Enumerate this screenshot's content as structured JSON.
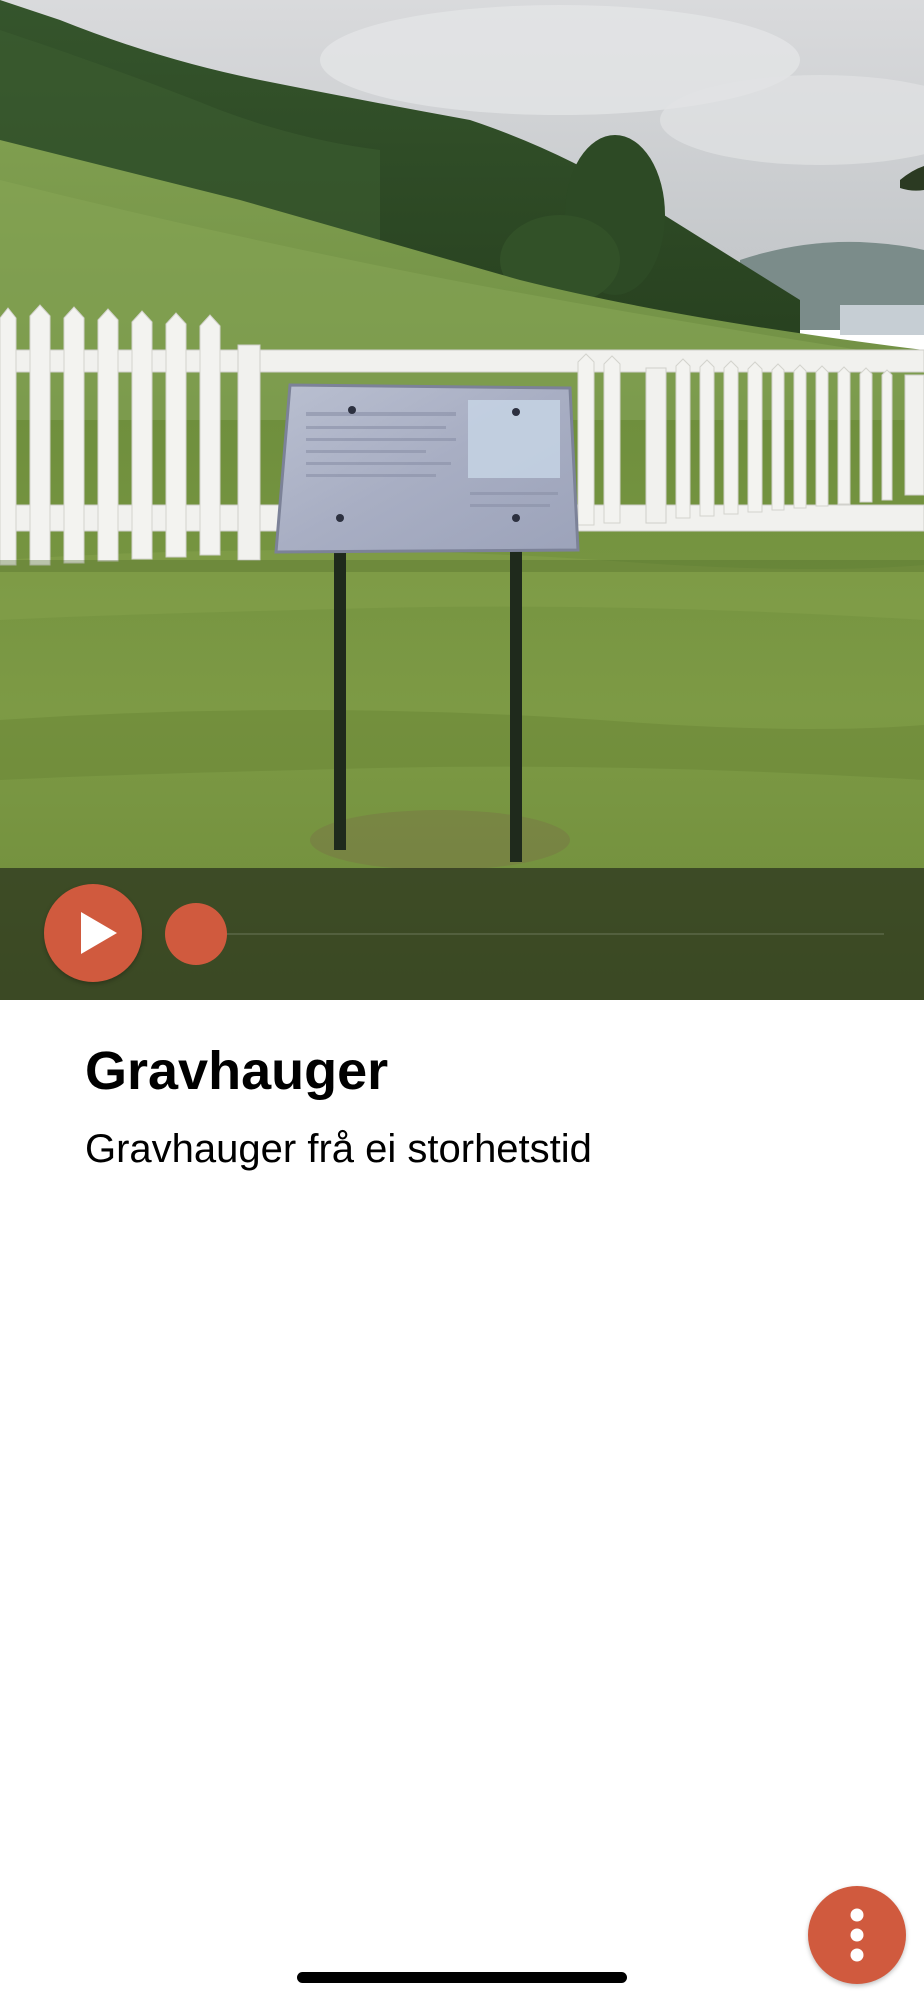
{
  "hero_image": {
    "icon": "landscape-photo-sign-by-fence"
  },
  "player": {
    "play_icon": "play-icon",
    "progress": 0,
    "accent_color": "#d05a3e"
  },
  "content": {
    "title": "Gravhauger",
    "subtitle": "Gravhauger frå ei storhetstid"
  },
  "fab": {
    "icon": "vertical-dots-icon"
  }
}
